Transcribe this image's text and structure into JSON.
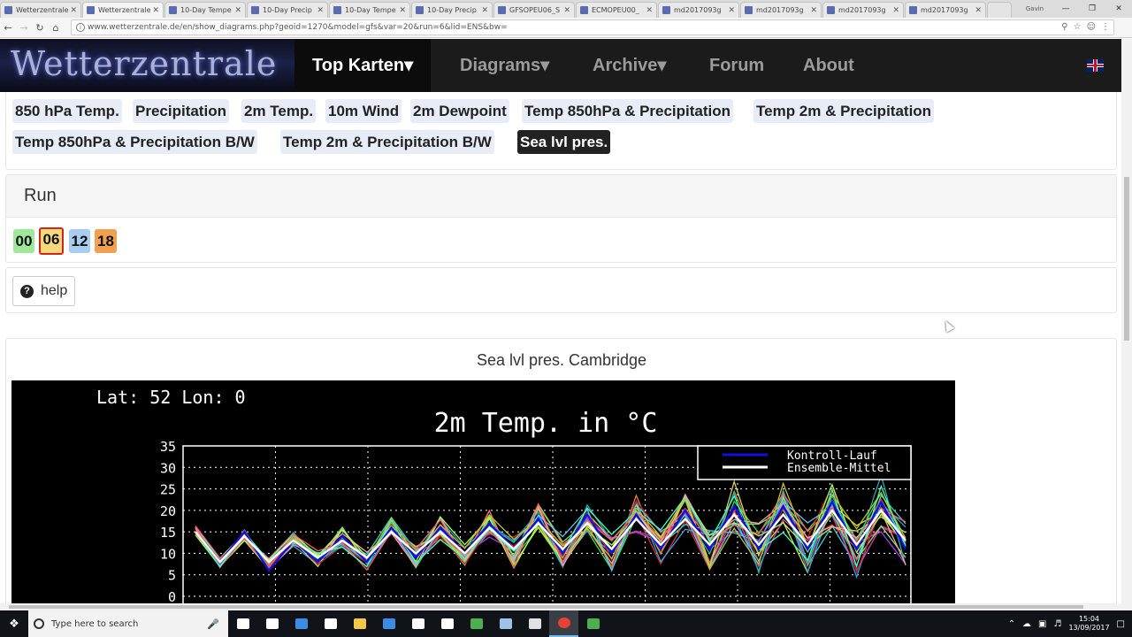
{
  "browser": {
    "tabs": [
      {
        "title": "Wetterzentrale",
        "active": false
      },
      {
        "title": "Wetterzentrale",
        "active": true
      },
      {
        "title": "10-Day Tempe",
        "active": false
      },
      {
        "title": "10-Day Precip",
        "active": false
      },
      {
        "title": "10-Day Tempe",
        "active": false
      },
      {
        "title": "10-Day Precip",
        "active": false
      },
      {
        "title": "GFSOPEU06_S",
        "active": false
      },
      {
        "title": "ECMOPEU00_",
        "active": false
      },
      {
        "title": "md2017093g",
        "active": false
      },
      {
        "title": "md2017093g",
        "active": false
      },
      {
        "title": "md2017093g",
        "active": false
      },
      {
        "title": "md2017093g",
        "active": false
      }
    ],
    "user_label": "Gavin",
    "url": "www.wetterzentrale.de/en/show_diagrams.php?geoid=1270&model=gfs&var=20&run=6&lid=ENS&bw="
  },
  "site": {
    "logo_text": "Wetterzentrale",
    "nav": [
      {
        "label": "Top Karten▾",
        "active": true
      },
      {
        "label": "Diagrams▾",
        "active": false
      },
      {
        "label": "Archive▾",
        "active": false
      },
      {
        "label": "Forum",
        "active": false
      },
      {
        "label": "About",
        "active": false
      }
    ]
  },
  "variables": [
    {
      "label": "850 hPa Temp.",
      "active": false
    },
    {
      "label": "Precipitation",
      "active": false
    },
    {
      "label": "2m Temp.",
      "active": false
    },
    {
      "label": "10m Wind",
      "active": false
    },
    {
      "label": "2m Dewpoint",
      "active": false
    },
    {
      "label": "Temp 850hPa & Precipitation",
      "active": false
    },
    {
      "label": "Temp 2m & Precipitation",
      "active": false
    },
    {
      "label": "Temp 850hPa & Precipitation B/W",
      "active": false
    },
    {
      "label": "Temp 2m & Precipitation B/W",
      "active": false
    },
    {
      "label": "Sea lvl pres.",
      "active": true
    }
  ],
  "run": {
    "heading": "Run",
    "options": [
      {
        "label": "00",
        "color": "#9de89a",
        "selected": false
      },
      {
        "label": "06",
        "color": "#f5d97c",
        "selected": true
      },
      {
        "label": "12",
        "color": "#a9cdf0",
        "selected": false
      },
      {
        "label": "18",
        "color": "#f0a04f",
        "selected": false
      }
    ]
  },
  "help": {
    "label": "help"
  },
  "diagram": {
    "title": "Sea lvl pres. Cambridge",
    "coords_label": "Lat: 52  Lon: 0",
    "chart_title": "2m Temp. in °C",
    "legend": [
      {
        "label": "Kontroll-Lauf",
        "color": "#1010e0"
      },
      {
        "label": "Ensemble-Mittel",
        "color": "#ffffff"
      }
    ]
  },
  "chart_data": {
    "type": "line",
    "title": "2m Temp. in °C",
    "ylim": [
      0,
      35
    ],
    "yticks": [
      0,
      5,
      10,
      15,
      20,
      25,
      30,
      35
    ],
    "grid": true,
    "legend_position": "top-right",
    "series": [
      {
        "name": "Kontroll-Lauf",
        "color": "#1010e0",
        "values": [
          15,
          8,
          15,
          6,
          13,
          8,
          14,
          8,
          16,
          9,
          16,
          10,
          17,
          11,
          18,
          10,
          19,
          10,
          19,
          11,
          20,
          11,
          21,
          11,
          21,
          11,
          22,
          11,
          22,
          11
        ]
      },
      {
        "name": "Ensemble-Mittel",
        "color": "#ffffff",
        "values": [
          15,
          8,
          14,
          8,
          13,
          9,
          13,
          9,
          15,
          10,
          15,
          10,
          16,
          11,
          17,
          11,
          17,
          11,
          18,
          12,
          18,
          12,
          19,
          12,
          19,
          12,
          20,
          12,
          20,
          13
        ]
      }
    ],
    "extra_members": 18
  },
  "taskbar": {
    "search_placeholder": "Type here to search",
    "time": "15:04",
    "date": "13/09/2017",
    "apps": [
      {
        "name": "task-view-icon",
        "color": "#ffffff"
      },
      {
        "name": "mail-icon",
        "color": "#ffffff"
      },
      {
        "name": "edge-icon",
        "color": "#3c8ce7"
      },
      {
        "name": "store-icon",
        "color": "#ffffff"
      },
      {
        "name": "file-explorer-icon",
        "color": "#f3c74a"
      },
      {
        "name": "onedrive-icon",
        "color": "#3c8ce7"
      },
      {
        "name": "calendar-icon",
        "color": "#ffffff"
      },
      {
        "name": "crosshair-icon",
        "color": "#ffffff"
      },
      {
        "name": "green-app-icon",
        "color": "#4caf50"
      },
      {
        "name": "globe-icon",
        "color": "#9ec2e6"
      },
      {
        "name": "paint-icon",
        "color": "#e0e0e0"
      },
      {
        "name": "chrome-icon",
        "color": "#e94235"
      },
      {
        "name": "green-app-2-icon",
        "color": "#4caf50"
      }
    ]
  }
}
